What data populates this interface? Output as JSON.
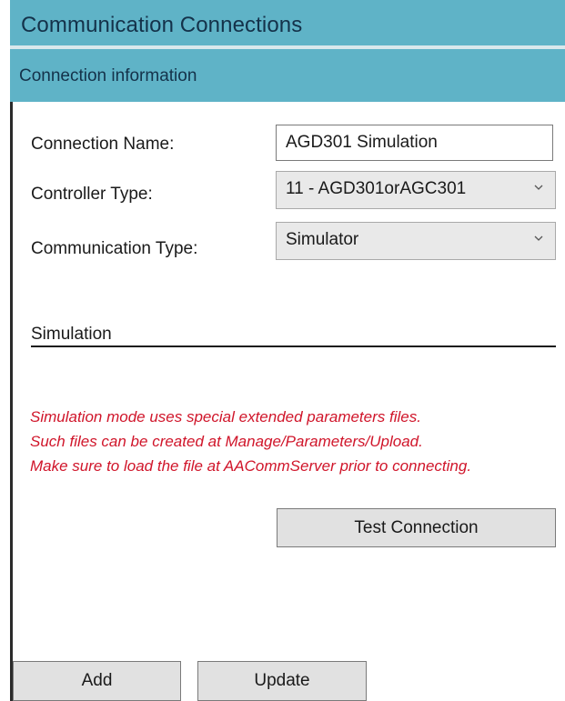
{
  "window": {
    "title": "Communication Connections",
    "section_title": "Connection information"
  },
  "form": {
    "connection_name": {
      "label": "Connection Name:",
      "value": "AGD301 Simulation"
    },
    "controller_type": {
      "label": "Controller Type:",
      "value": "11 - AGD301orAGC301"
    },
    "communication_type": {
      "label": "Communication Type:",
      "value": "Simulator"
    }
  },
  "simulation": {
    "header": "Simulation",
    "notice_lines": [
      "Simulation mode uses special extended parameters files.",
      "Such files can be created at Manage/Parameters/Upload.",
      "Make sure to load the file at AACommServer prior to connecting."
    ],
    "notice_color": "#d0152a"
  },
  "buttons": {
    "test_connection": "Test Connection",
    "add": "Add",
    "update": "Update"
  },
  "icons": {
    "dropdown": "chevron-down-icon"
  },
  "colors": {
    "header_bar": "#5fb3c7",
    "header_text": "#14324a",
    "button_bg": "#e1e1e1",
    "select_bg": "#e9e9e9"
  }
}
